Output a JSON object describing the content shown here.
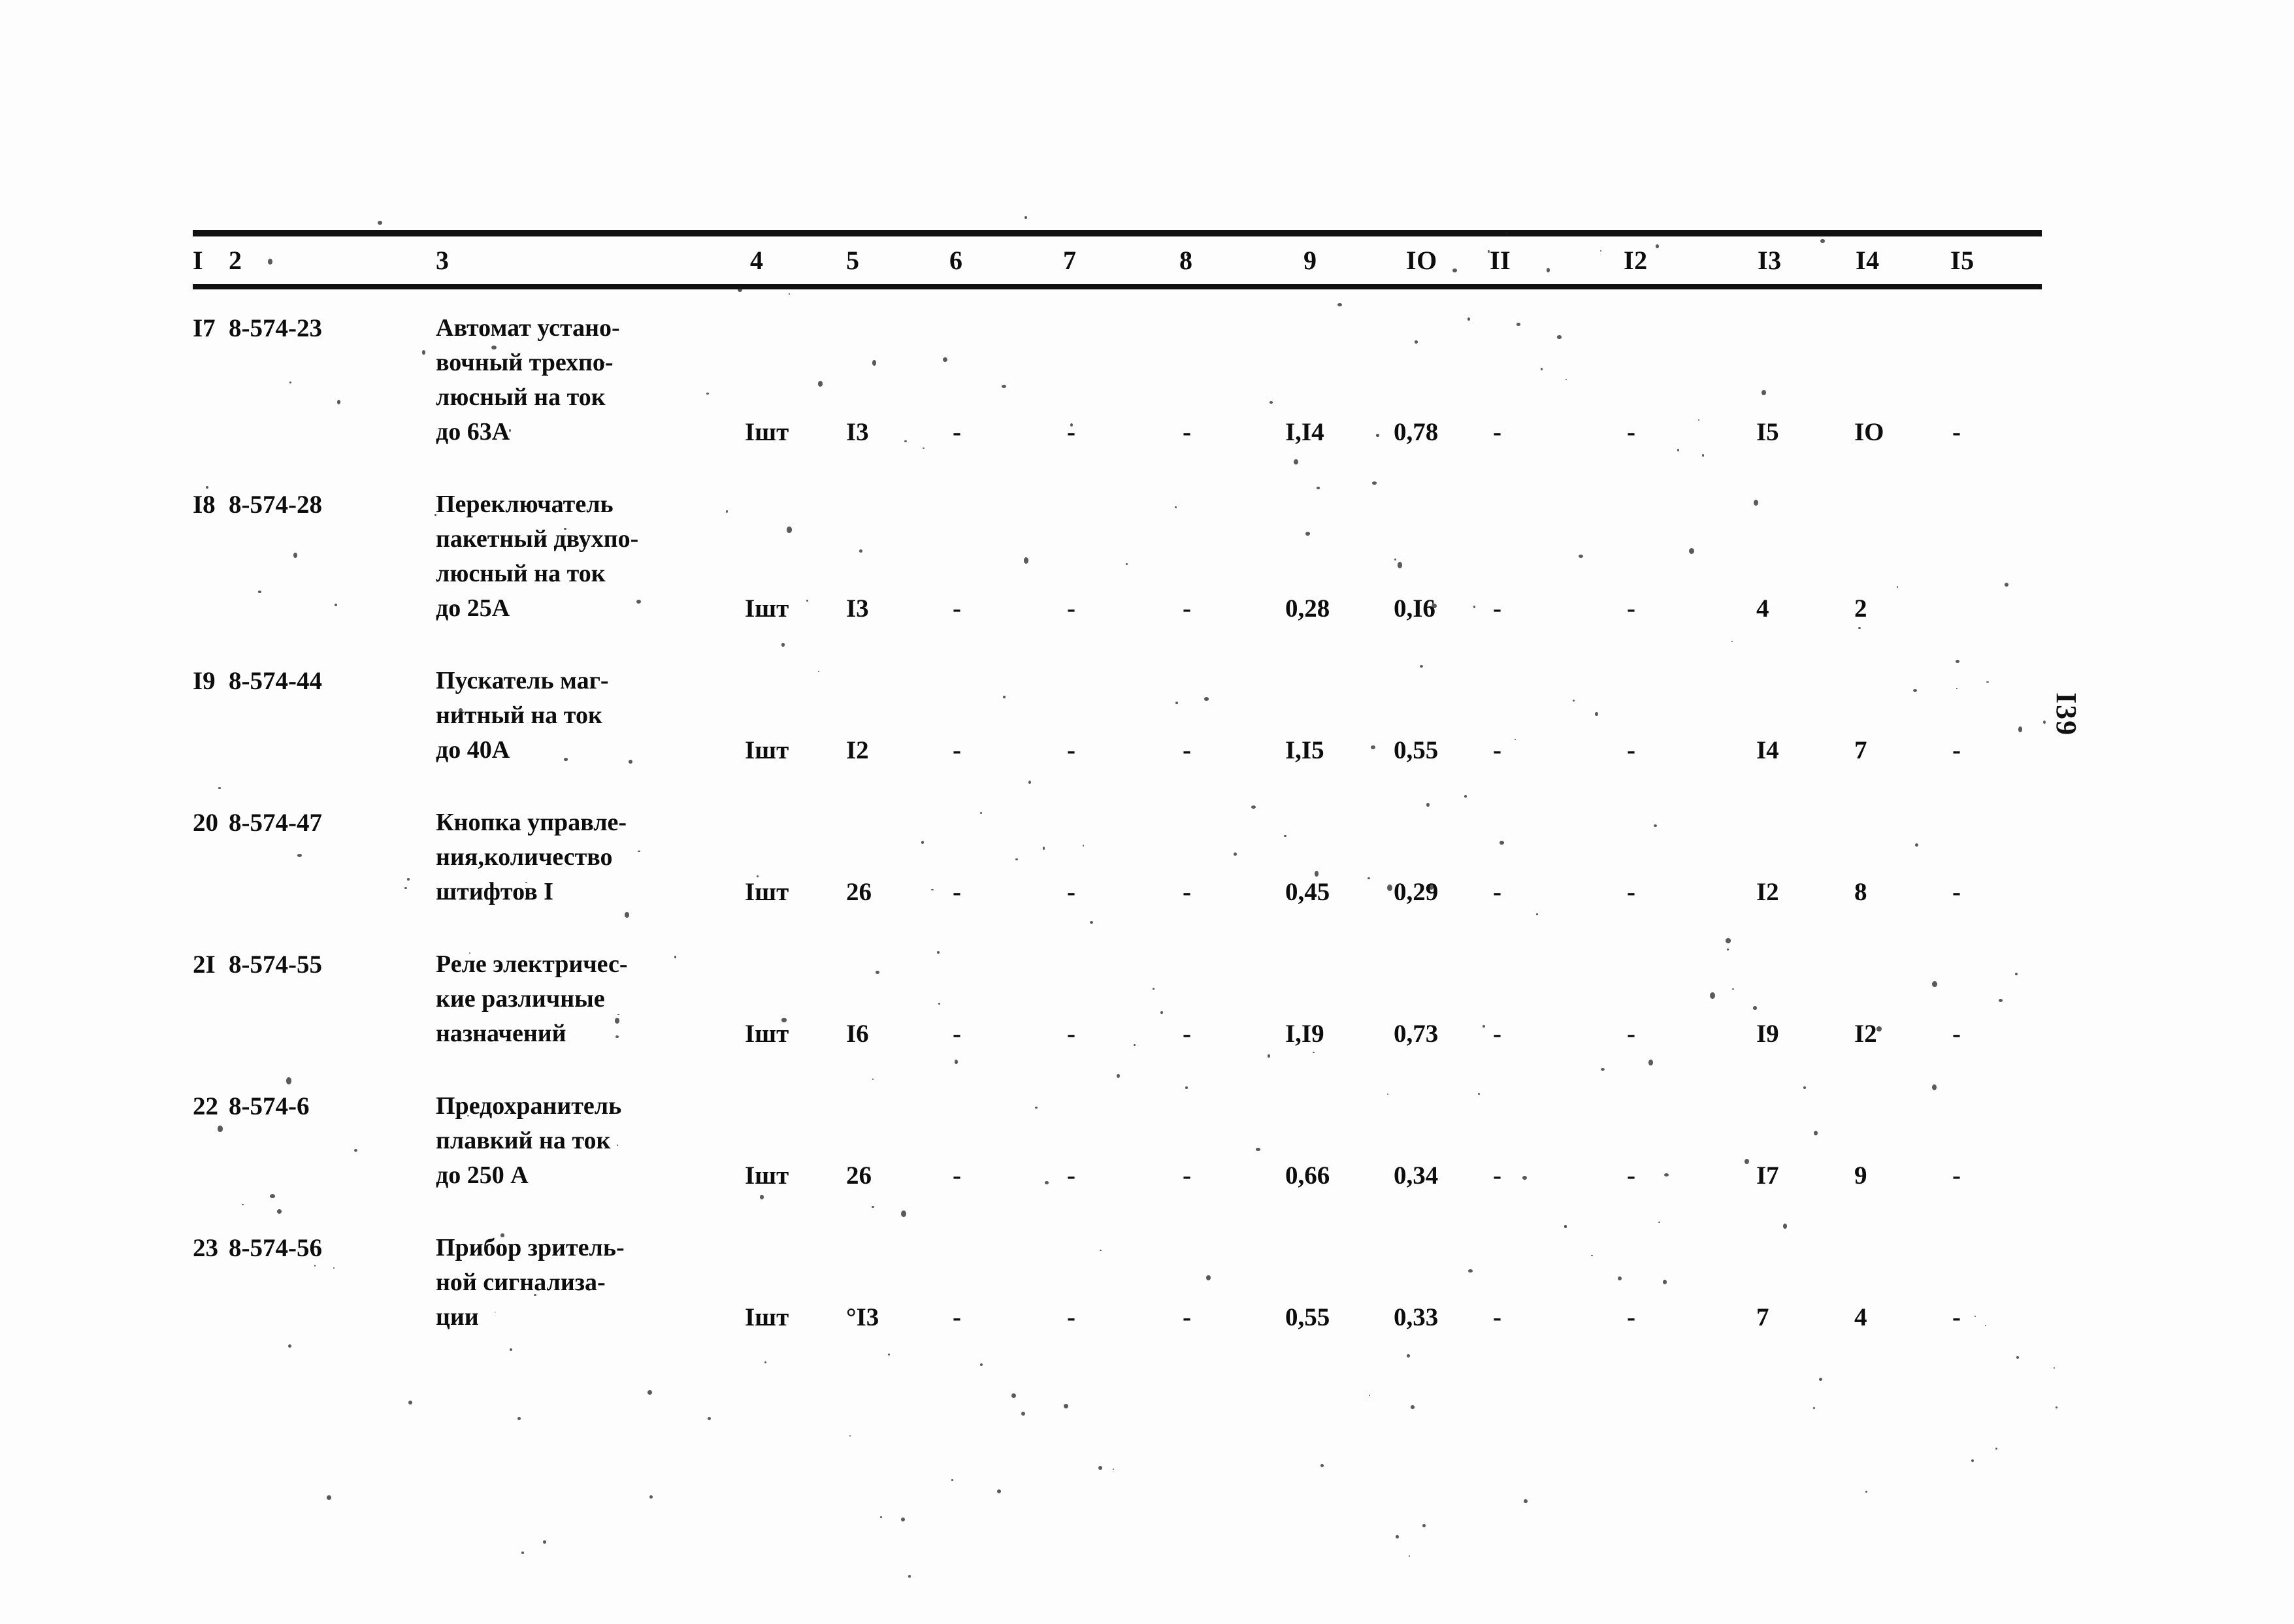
{
  "document": {
    "folio": "I39",
    "type": "scanned-table-page"
  },
  "table": {
    "columns": [
      "I",
      "2",
      "3",
      "4",
      "5",
      "6",
      "7",
      "8",
      "9",
      "IO",
      "II",
      "I2",
      "I3",
      "I4",
      "I5"
    ],
    "rows": [
      {
        "c1": "I7",
        "c2": "8-574-23",
        "desc": [
          "Автомат устано-",
          "вочный трехпо-",
          "люсный на ток",
          "до 63А"
        ],
        "c4": "Iшт",
        "c5": "I3",
        "c6": "-",
        "c7": "-",
        "c8": "-",
        "c9": "I,I4",
        "c10": "0,78",
        "c11": "-",
        "c12": "-",
        "c13": "I5",
        "c14": "IO",
        "c15": "-"
      },
      {
        "c1": "I8",
        "c2": "8-574-28",
        "desc": [
          "Переключатель",
          "пакетный двухпо-",
          "люсный на ток",
          "до 25А"
        ],
        "c4": "Iшт",
        "c5": "I3",
        "c6": "-",
        "c7": "-",
        "c8": "-",
        "c9": "0,28",
        "c10": "0,I6",
        "c11": "-",
        "c12": "-",
        "c13": "4",
        "c14": "2",
        "c15": ""
      },
      {
        "c1": "I9",
        "c2": "8-574-44",
        "desc": [
          "Пускатель маг-",
          "нитный на ток",
          "до 40А"
        ],
        "c4": "Iшт",
        "c5": "I2",
        "c6": "-",
        "c7": "-",
        "c8": "-",
        "c9": "I,I5",
        "c10": "0,55",
        "c11": "-",
        "c12": "-",
        "c13": "I4",
        "c14": "7",
        "c15": "-"
      },
      {
        "c1": "20",
        "c2": "8-574-47",
        "desc": [
          "Кнопка управле-",
          "ния,количество",
          "штифтов I"
        ],
        "c4": "Iшт",
        "c5": "26",
        "c6": "-",
        "c7": "-",
        "c8": "-",
        "c9": "0,45",
        "c10": "0,29",
        "c11": "-",
        "c12": "-",
        "c13": "I2",
        "c14": "8",
        "c15": "-"
      },
      {
        "c1": "2I",
        "c2": "8-574-55",
        "desc": [
          "Реле электричес-",
          "кие различные",
          "назначений"
        ],
        "c4": "Iшт",
        "c5": "I6",
        "c6": "-",
        "c7": "-",
        "c8": "-",
        "c9": "I,I9",
        "c10": "0,73",
        "c11": "-",
        "c12": "-",
        "c13": "I9",
        "c14": "I2",
        "c15": "-"
      },
      {
        "c1": "22",
        "c2": "8-574-6",
        "desc": [
          "Предохранитель",
          "плавкий на ток",
          "до 250 А"
        ],
        "c4": "Iшт",
        "c5": "26",
        "c6": "-",
        "c7": "-",
        "c8": "-",
        "c9": "0,66",
        "c10": "0,34",
        "c11": "-",
        "c12": "-",
        "c13": "I7",
        "c14": "9",
        "c15": "-"
      },
      {
        "c1": "23",
        "c2": "8-574-56",
        "desc": [
          "Прибор зритель-",
          "ной сигнализа-",
          "ции"
        ],
        "c4": "Iшт",
        "c5": "°I3",
        "c6": "-",
        "c7": "-",
        "c8": "-",
        "c9": "0,55",
        "c10": "0,33",
        "c11": "-",
        "c12": "-",
        "c13": "7",
        "c14": "4",
        "c15": "-"
      }
    ]
  }
}
